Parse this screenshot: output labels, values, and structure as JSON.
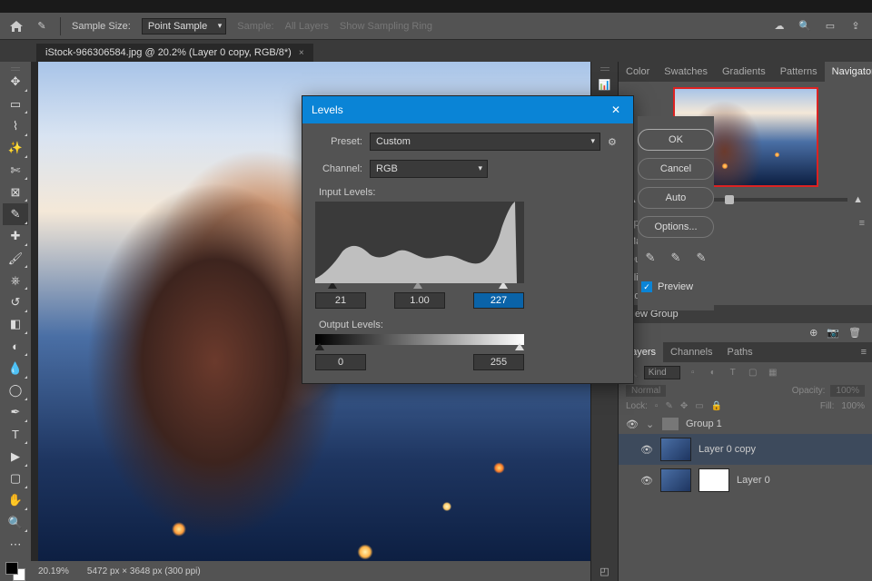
{
  "optionbar": {
    "sample_size_label": "Sample Size:",
    "sample_size_value": "Point Sample",
    "sample_label": "Sample:",
    "sample_value": "All Layers",
    "show_ring": "Show Sampling Ring"
  },
  "doctab": {
    "title": "iStock-966306584.jpg @ 20.2% (Layer 0 copy, RGB/8*)"
  },
  "status": {
    "zoom": "20.19%",
    "dims": "5472 px × 3648 px (300 ppi)"
  },
  "nav_tabs": [
    "Color",
    "Swatches",
    "Gradients",
    "Patterns",
    "Navigator"
  ],
  "actions": {
    "head": "Open",
    "items": [
      "Make Layer",
      "Duplicate Layer",
      "Flip Horizontal",
      "Add Layer Mask",
      "New Group"
    ]
  },
  "layer_tabs": [
    "Layers",
    "Channels",
    "Paths"
  ],
  "layer_filter": "Kind",
  "blend": {
    "mode": "Normal",
    "opacity_label": "Opacity:",
    "opacity": "100%",
    "fill_label": "Fill:",
    "fill": "100%"
  },
  "lock_label": "Lock:",
  "layers": [
    {
      "name": "Group 1"
    },
    {
      "name": "Layer 0 copy"
    },
    {
      "name": "Layer 0"
    }
  ],
  "levels": {
    "title": "Levels",
    "preset_label": "Preset:",
    "preset_value": "Custom",
    "channel_label": "Channel:",
    "channel_value": "RGB",
    "input_label": "Input Levels:",
    "output_label": "Output Levels:",
    "in_black": "21",
    "in_gamma": "1.00",
    "in_white": "227",
    "out_black": "0",
    "out_white": "255",
    "ok": "OK",
    "cancel": "Cancel",
    "auto": "Auto",
    "options": "Options...",
    "preview": "Preview"
  }
}
